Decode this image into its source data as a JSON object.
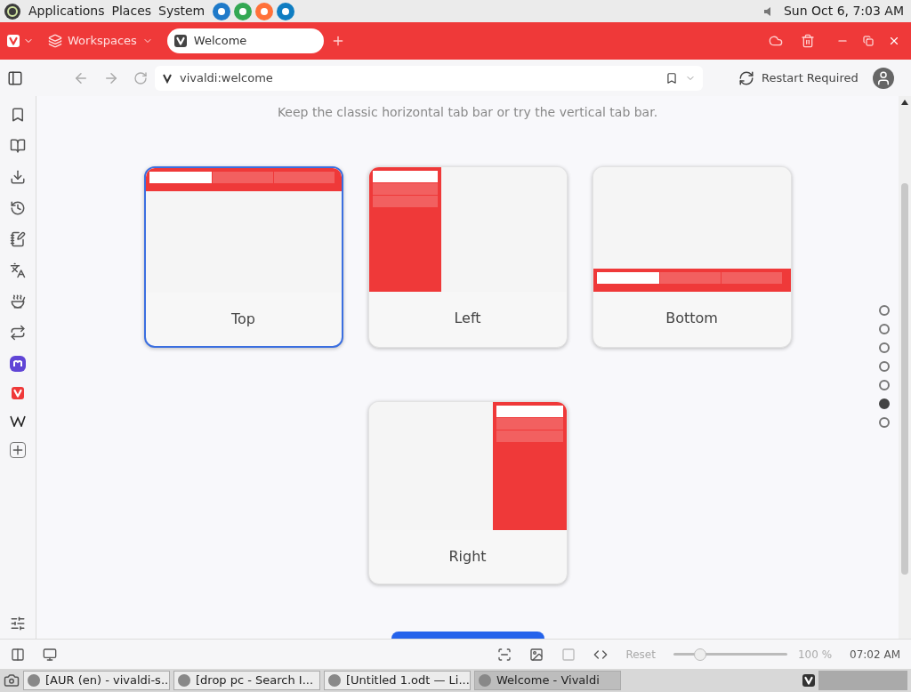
{
  "top_panel": {
    "menus": [
      "Applications",
      "Places",
      "System"
    ],
    "clock": "Sun Oct  6, 7:03 AM"
  },
  "browser": {
    "workspaces": "Workspaces",
    "tabs": [
      {
        "label": "Welcome",
        "selected": true
      }
    ],
    "address": "vivaldi:welcome",
    "restart": "Restart Required"
  },
  "page": {
    "subtitle": "Keep the classic horizontal tab bar or try the vertical tab bar.",
    "options": [
      {
        "kind": "top",
        "label": "Top",
        "selected": true
      },
      {
        "kind": "left",
        "label": "Left",
        "selected": false
      },
      {
        "kind": "bottom",
        "label": "Bottom",
        "selected": false
      },
      {
        "kind": "right",
        "label": "Right",
        "selected": false
      }
    ],
    "steps": [
      {
        "selected": false
      },
      {
        "selected": false
      },
      {
        "selected": false
      },
      {
        "selected": false
      },
      {
        "selected": false
      },
      {
        "selected": true
      },
      {
        "selected": false
      }
    ]
  },
  "status_bar": {
    "reset": "Reset",
    "zoom": {
      "level": 0.2
    },
    "zoom_reading": "100 %",
    "time": "07:02 AM"
  },
  "taskbar": [
    {
      "label": "[AUR (en) - vivaldi-s...",
      "selected": false
    },
    {
      "label": "[drop pc - Search I...",
      "selected": false
    },
    {
      "label": "[Untitled 1.odt — Li...",
      "selected": false
    },
    {
      "label": "Welcome - Vivaldi",
      "selected": true
    }
  ]
}
